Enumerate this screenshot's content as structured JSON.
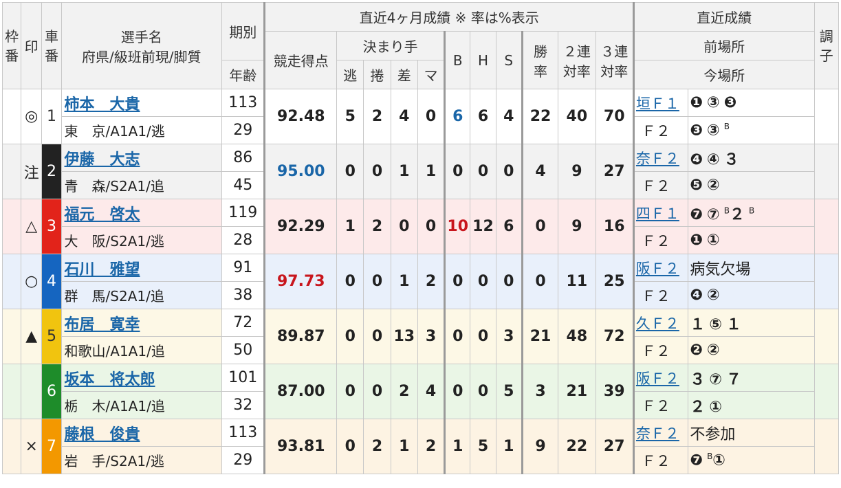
{
  "header": {
    "waku": "枠番",
    "mark": "印",
    "car": "車番",
    "name_top": "選手名",
    "name_bottom": "府県/級班前現/脚質",
    "term": "期別",
    "age": "年齢",
    "recent_group": "直近4ヶ月成績 ※ 率は%表示",
    "points": "競走得点",
    "kimarite": "決まり手",
    "k_nige": "逃",
    "k_makuri": "捲",
    "k_sashi": "差",
    "k_ma": "マ",
    "b": "B",
    "h": "H",
    "s": "S",
    "win_top": "勝",
    "win_bottom": "率",
    "ren2_top": "２連",
    "ren2_bottom": "対率",
    "ren3_top": "３連",
    "ren3_bottom": "対率",
    "recent_results": "直近成績",
    "prev_venue": "前場所",
    "this_venue": "今場所",
    "condition": "調子"
  },
  "riders": [
    {
      "mark": "◎",
      "car": "1",
      "name": "柿本　大貴",
      "pref": "東　京/A1A1/逃",
      "term": "113",
      "age": "29",
      "points": "92.48",
      "nige": "5",
      "makuri": "2",
      "sashi": "4",
      "ma": "0",
      "b": "6",
      "h": "6",
      "s": "4",
      "win": "22",
      "ren2": "40",
      "ren3": "70",
      "prev_venue": "垣Ｆ１",
      "prev_results": "❶③❸",
      "this_venue": "Ｆ２",
      "this_results": "❸③",
      "this_sup": "B"
    },
    {
      "mark": "注",
      "car": "2",
      "name": "伊藤　大志",
      "pref": "青　森/S2A1/追",
      "term": "86",
      "age": "45",
      "points": "95.00",
      "nige": "0",
      "makuri": "0",
      "sashi": "1",
      "ma": "1",
      "b": "0",
      "h": "0",
      "s": "0",
      "win": "4",
      "ren2": "9",
      "ren3": "27",
      "prev_venue": "奈Ｆ２",
      "prev_results": "❹④３",
      "this_venue": "Ｆ２",
      "this_results": "❺②",
      "this_sup": ""
    },
    {
      "mark": "△",
      "car": "3",
      "name": "福元　啓太",
      "pref": "大　阪/S2A1/逃",
      "term": "119",
      "age": "28",
      "points": "92.29",
      "nige": "1",
      "makuri": "2",
      "sashi": "0",
      "ma": "0",
      "b": "10",
      "h": "12",
      "s": "6",
      "win": "0",
      "ren2": "9",
      "ren3": "16",
      "prev_venue": "四Ｆ１",
      "prev_results": "❼⑦",
      "prev_sup1": "B",
      "prev_after": "２",
      "prev_sup2": "B",
      "this_venue": "Ｆ２",
      "this_results": "❶①",
      "this_sup": ""
    },
    {
      "mark": "○",
      "car": "4",
      "name": "石川　雅望",
      "pref": "群　馬/S2A1/追",
      "term": "91",
      "age": "38",
      "points": "97.73",
      "nige": "0",
      "makuri": "0",
      "sashi": "1",
      "ma": "2",
      "b": "0",
      "h": "0",
      "s": "0",
      "win": "0",
      "ren2": "11",
      "ren3": "25",
      "prev_venue": "阪Ｆ２",
      "prev_results": "病気欠場",
      "this_venue": "Ｆ２",
      "this_results": "❹②",
      "this_sup": ""
    },
    {
      "mark": "▲",
      "car": "5",
      "name": "布居　寛幸",
      "pref": "和歌山/A1A1/追",
      "term": "72",
      "age": "50",
      "points": "89.87",
      "nige": "0",
      "makuri": "0",
      "sashi": "13",
      "ma": "3",
      "b": "0",
      "h": "0",
      "s": "3",
      "win": "21",
      "ren2": "48",
      "ren3": "72",
      "prev_venue": "久Ｆ２",
      "prev_results": "１⑤１",
      "this_venue": "Ｆ２",
      "this_results": "❷②",
      "this_sup": ""
    },
    {
      "mark": "",
      "car": "6",
      "name": "坂本　将太郎",
      "pref": "栃　木/A1A1/追",
      "term": "101",
      "age": "32",
      "points": "87.00",
      "nige": "0",
      "makuri": "0",
      "sashi": "2",
      "ma": "4",
      "b": "0",
      "h": "0",
      "s": "5",
      "win": "3",
      "ren2": "21",
      "ren3": "39",
      "prev_venue": "阪Ｆ２",
      "prev_results": "３⑦７",
      "this_venue": "Ｆ２",
      "this_results": "２①",
      "this_sup": ""
    },
    {
      "mark": "×",
      "car": "7",
      "name": "藤根　俊貴",
      "pref": "岩　手/S2A1/逃",
      "term": "113",
      "age": "29",
      "points": "93.81",
      "nige": "0",
      "makuri": "2",
      "sashi": "1",
      "ma": "2",
      "b": "1",
      "h": "5",
      "s": "1",
      "win": "9",
      "ren2": "22",
      "ren3": "27",
      "prev_venue": "奈Ｆ２",
      "prev_results": "不参加",
      "this_venue": "Ｆ２",
      "this_results": "❼",
      "this_sup": "B",
      "this_after": "①"
    }
  ]
}
